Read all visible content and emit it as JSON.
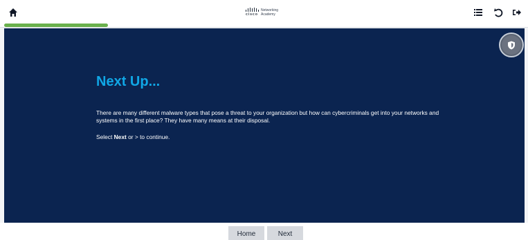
{
  "header": {
    "brand_name": "cisco",
    "brand_line1": "Networking",
    "brand_line2": "Academy",
    "icons": [
      "home-icon",
      "menu-list-icon",
      "undo-icon",
      "exit-icon"
    ]
  },
  "progress": {
    "fraction": 0.2,
    "color": "#6ab04c"
  },
  "content": {
    "headline": "Next Up...",
    "paragraph": "There are many different malware types that pose a threat to your organization but how can cybercriminals get into your networks and systems in the first place? They have many means at their disposal.",
    "continue_prefix": "Select ",
    "continue_bold": "Next",
    "continue_suffix": " or > to continue."
  },
  "footer": {
    "home_label": "Home",
    "next_label": "Next"
  },
  "colors": {
    "main_bg": "#0b2450",
    "headline": "#10a7e6",
    "accent_progress": "#6ab04c"
  }
}
